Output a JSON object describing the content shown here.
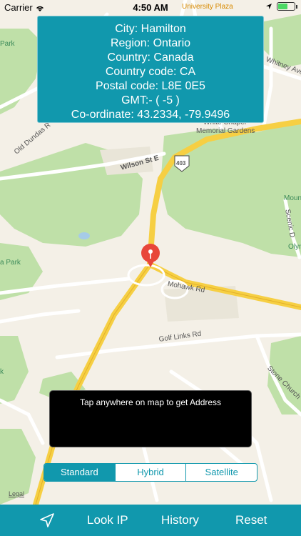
{
  "status_bar": {
    "carrier": "Carrier",
    "time": "4:50 AM"
  },
  "map_labels": {
    "university_plaza": "University Plaza",
    "park_left": "Park",
    "old_dundas": "Old Dundas R",
    "wilson_st": "Wilson St E",
    "whitney": "Whitney Ave",
    "white_chapel": "White Chapel",
    "memorial_gardens": "Memorial Gardens",
    "highway_shield": "403",
    "mount": "Moun",
    "scenic": "Scenic D",
    "olympic": "Olym",
    "a_park": "a Park",
    "mohawk": "Mohawk Rd",
    "golf_links": "Golf Links Rd",
    "stone_church": "Stone Church",
    "k_label": "k",
    "legal": "Legal"
  },
  "info": {
    "city": "City: Hamilton",
    "region": "Region: Ontario",
    "country": "Country: Canada",
    "country_code": "Country code: CA",
    "postal_code": "Postal code: L8E 0E5",
    "gmt": "GMT:- ( -5 )",
    "coordinate": "Co-ordinate: 43.2334, -79.9496"
  },
  "message": "Tap anywhere on map to get Address",
  "map_types": {
    "standard": "Standard",
    "hybrid": "Hybrid",
    "satellite": "Satellite",
    "selected": "Standard"
  },
  "toolbar": {
    "navigate_icon": "location-arrow-icon",
    "look_ip": "Look IP",
    "history": "History",
    "reset": "Reset"
  },
  "colors": {
    "accent": "#1198ad",
    "pin": "#e8463a",
    "highway": "#f6cf43",
    "park": "#b9dca5"
  }
}
